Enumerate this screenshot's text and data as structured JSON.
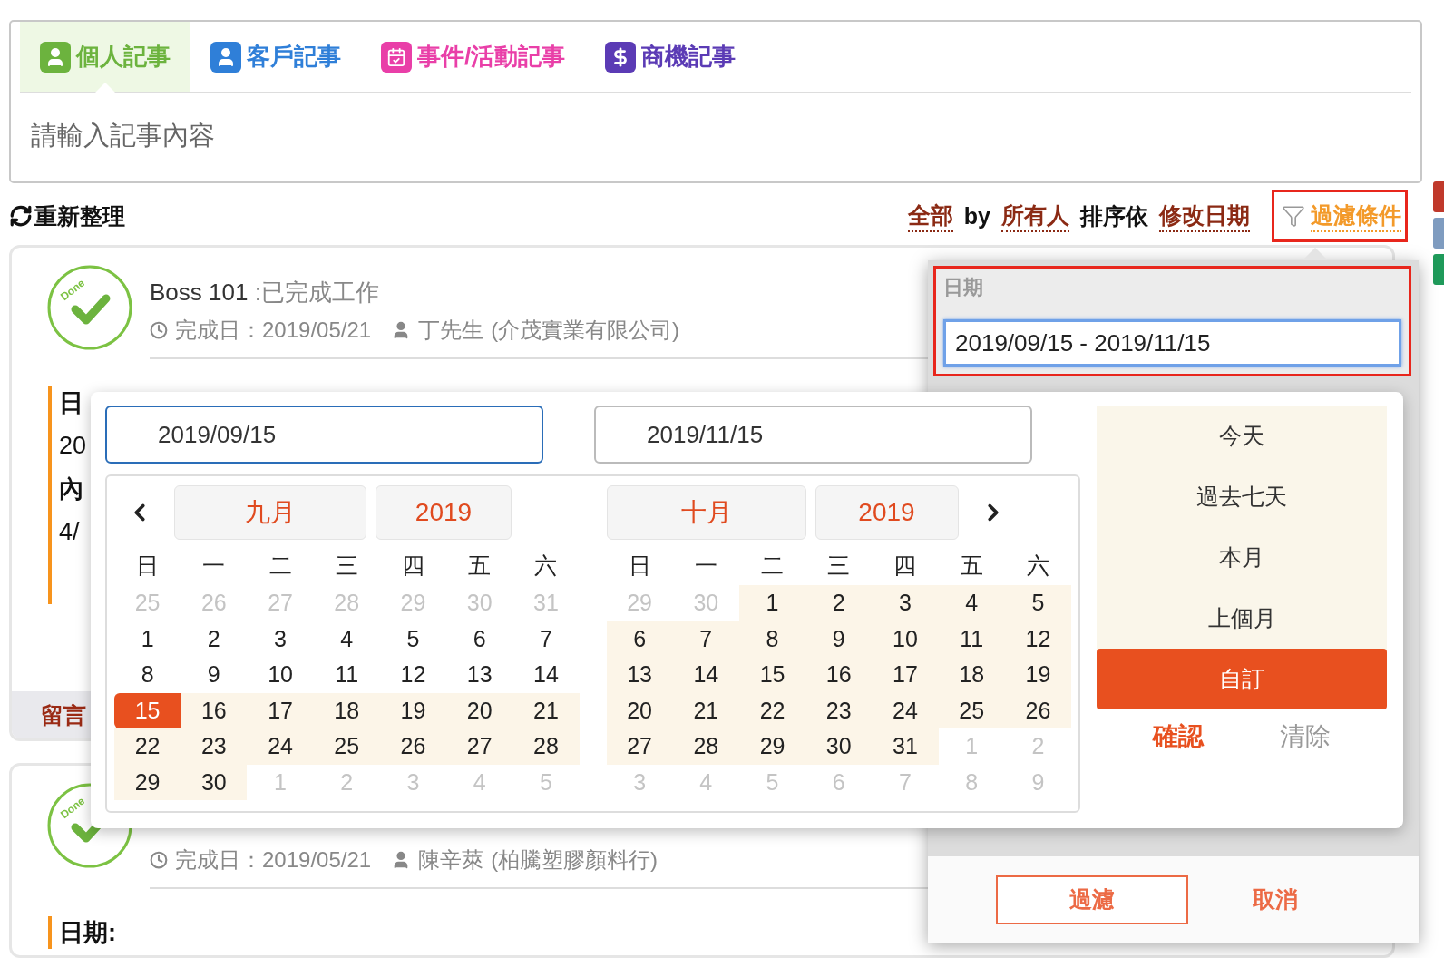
{
  "note_tabs": [
    {
      "label": "個人記事",
      "kind": "person",
      "color": "#6cb33e",
      "selected": true
    },
    {
      "label": "客戶記事",
      "kind": "customer",
      "color": "#2f7fd8",
      "selected": false
    },
    {
      "label": "事件/活動記事",
      "kind": "event",
      "color": "#e93fa8",
      "selected": false
    },
    {
      "label": "商機記事",
      "kind": "deal",
      "color": "#5b3bb5",
      "selected": false
    }
  ],
  "note_input": {
    "placeholder": "請輸入記事內容"
  },
  "toolbar": {
    "refresh": "重新整理",
    "filter_summary": [
      {
        "text": "全部",
        "kind": "link"
      },
      {
        "text": "by",
        "kind": "plain"
      },
      {
        "text": "所有人",
        "kind": "link"
      },
      {
        "text": "排序依",
        "kind": "plain"
      },
      {
        "text": "修改日期",
        "kind": "link"
      }
    ],
    "filter_button": "過濾條件"
  },
  "cards": [
    {
      "stamp": "Done",
      "title": "Boss 101",
      "status": ":已完成工作",
      "date_label": "完成日：2019/05/21",
      "person": "丁先生",
      "company": "(介茂實業有限公司)",
      "content": [
        {
          "text": "日",
          "kind": "label"
        },
        {
          "text": "20",
          "kind": "value"
        },
        {
          "text": "內",
          "kind": "label"
        },
        {
          "text": "4/",
          "kind": "value"
        }
      ],
      "comment": "留言"
    },
    {
      "stamp": "Done",
      "date_label": "完成日：2019/05/21",
      "person": "陳辛萊",
      "company": "(柏騰塑膠顏料行)",
      "content": [
        {
          "text": "日期:",
          "kind": "label"
        }
      ]
    }
  ],
  "filter_popover": {
    "section": "日期",
    "range_value": "2019/09/15 - 2019/11/15",
    "apply": "過濾",
    "cancel": "取消"
  },
  "date_picker": {
    "start_input": "2019/09/15",
    "end_input": "2019/11/15",
    "calendars": [
      {
        "month": "九月",
        "year": "2019",
        "weekdays": [
          "日",
          "一",
          "二",
          "三",
          "四",
          "五",
          "六"
        ],
        "weeks": [
          [
            {
              "d": "25",
              "kind": "off"
            },
            {
              "d": "26",
              "kind": "off"
            },
            {
              "d": "27",
              "kind": "off"
            },
            {
              "d": "28",
              "kind": "off"
            },
            {
              "d": "29",
              "kind": "off"
            },
            {
              "d": "30",
              "kind": "off"
            },
            {
              "d": "31",
              "kind": "off"
            }
          ],
          [
            {
              "d": "1",
              "kind": "normal"
            },
            {
              "d": "2",
              "kind": "normal"
            },
            {
              "d": "3",
              "kind": "normal"
            },
            {
              "d": "4",
              "kind": "normal"
            },
            {
              "d": "5",
              "kind": "normal"
            },
            {
              "d": "6",
              "kind": "normal"
            },
            {
              "d": "7",
              "kind": "normal"
            }
          ],
          [
            {
              "d": "8",
              "kind": "normal"
            },
            {
              "d": "9",
              "kind": "normal"
            },
            {
              "d": "10",
              "kind": "normal"
            },
            {
              "d": "11",
              "kind": "normal"
            },
            {
              "d": "12",
              "kind": "normal"
            },
            {
              "d": "13",
              "kind": "normal"
            },
            {
              "d": "14",
              "kind": "normal"
            }
          ],
          [
            {
              "d": "15",
              "kind": "start"
            },
            {
              "d": "16",
              "kind": "range"
            },
            {
              "d": "17",
              "kind": "range"
            },
            {
              "d": "18",
              "kind": "range"
            },
            {
              "d": "19",
              "kind": "range"
            },
            {
              "d": "20",
              "kind": "range"
            },
            {
              "d": "21",
              "kind": "range"
            }
          ],
          [
            {
              "d": "22",
              "kind": "range"
            },
            {
              "d": "23",
              "kind": "range"
            },
            {
              "d": "24",
              "kind": "range"
            },
            {
              "d": "25",
              "kind": "range"
            },
            {
              "d": "26",
              "kind": "range"
            },
            {
              "d": "27",
              "kind": "range"
            },
            {
              "d": "28",
              "kind": "range"
            }
          ],
          [
            {
              "d": "29",
              "kind": "range"
            },
            {
              "d": "30",
              "kind": "range"
            },
            {
              "d": "1",
              "kind": "off"
            },
            {
              "d": "2",
              "kind": "off"
            },
            {
              "d": "3",
              "kind": "off"
            },
            {
              "d": "4",
              "kind": "off"
            },
            {
              "d": "5",
              "kind": "off"
            }
          ]
        ]
      },
      {
        "month": "十月",
        "year": "2019",
        "weekdays": [
          "日",
          "一",
          "二",
          "三",
          "四",
          "五",
          "六"
        ],
        "weeks": [
          [
            {
              "d": "29",
              "kind": "off"
            },
            {
              "d": "30",
              "kind": "off"
            },
            {
              "d": "1",
              "kind": "range"
            },
            {
              "d": "2",
              "kind": "range"
            },
            {
              "d": "3",
              "kind": "range"
            },
            {
              "d": "4",
              "kind": "range"
            },
            {
              "d": "5",
              "kind": "range"
            }
          ],
          [
            {
              "d": "6",
              "kind": "range"
            },
            {
              "d": "7",
              "kind": "range"
            },
            {
              "d": "8",
              "kind": "range"
            },
            {
              "d": "9",
              "kind": "range"
            },
            {
              "d": "10",
              "kind": "range"
            },
            {
              "d": "11",
              "kind": "range"
            },
            {
              "d": "12",
              "kind": "range"
            }
          ],
          [
            {
              "d": "13",
              "kind": "range"
            },
            {
              "d": "14",
              "kind": "range"
            },
            {
              "d": "15",
              "kind": "range"
            },
            {
              "d": "16",
              "kind": "range"
            },
            {
              "d": "17",
              "kind": "range"
            },
            {
              "d": "18",
              "kind": "range"
            },
            {
              "d": "19",
              "kind": "range"
            }
          ],
          [
            {
              "d": "20",
              "kind": "range"
            },
            {
              "d": "21",
              "kind": "range"
            },
            {
              "d": "22",
              "kind": "range"
            },
            {
              "d": "23",
              "kind": "range"
            },
            {
              "d": "24",
              "kind": "range"
            },
            {
              "d": "25",
              "kind": "range"
            },
            {
              "d": "26",
              "kind": "range"
            }
          ],
          [
            {
              "d": "27",
              "kind": "range"
            },
            {
              "d": "28",
              "kind": "range"
            },
            {
              "d": "29",
              "kind": "range"
            },
            {
              "d": "30",
              "kind": "range"
            },
            {
              "d": "31",
              "kind": "range"
            },
            {
              "d": "1",
              "kind": "off"
            },
            {
              "d": "2",
              "kind": "off"
            }
          ],
          [
            {
              "d": "3",
              "kind": "off"
            },
            {
              "d": "4",
              "kind": "off"
            },
            {
              "d": "5",
              "kind": "off"
            },
            {
              "d": "6",
              "kind": "off"
            },
            {
              "d": "7",
              "kind": "off"
            },
            {
              "d": "8",
              "kind": "off"
            },
            {
              "d": "9",
              "kind": "off"
            }
          ]
        ]
      }
    ],
    "ranges": [
      {
        "label": "今天",
        "selected": false
      },
      {
        "label": "過去七天",
        "selected": false
      },
      {
        "label": "本月",
        "selected": false
      },
      {
        "label": "上個月",
        "selected": false
      },
      {
        "label": "自訂",
        "selected": true
      }
    ],
    "confirm": "確認",
    "clear": "清除"
  }
}
